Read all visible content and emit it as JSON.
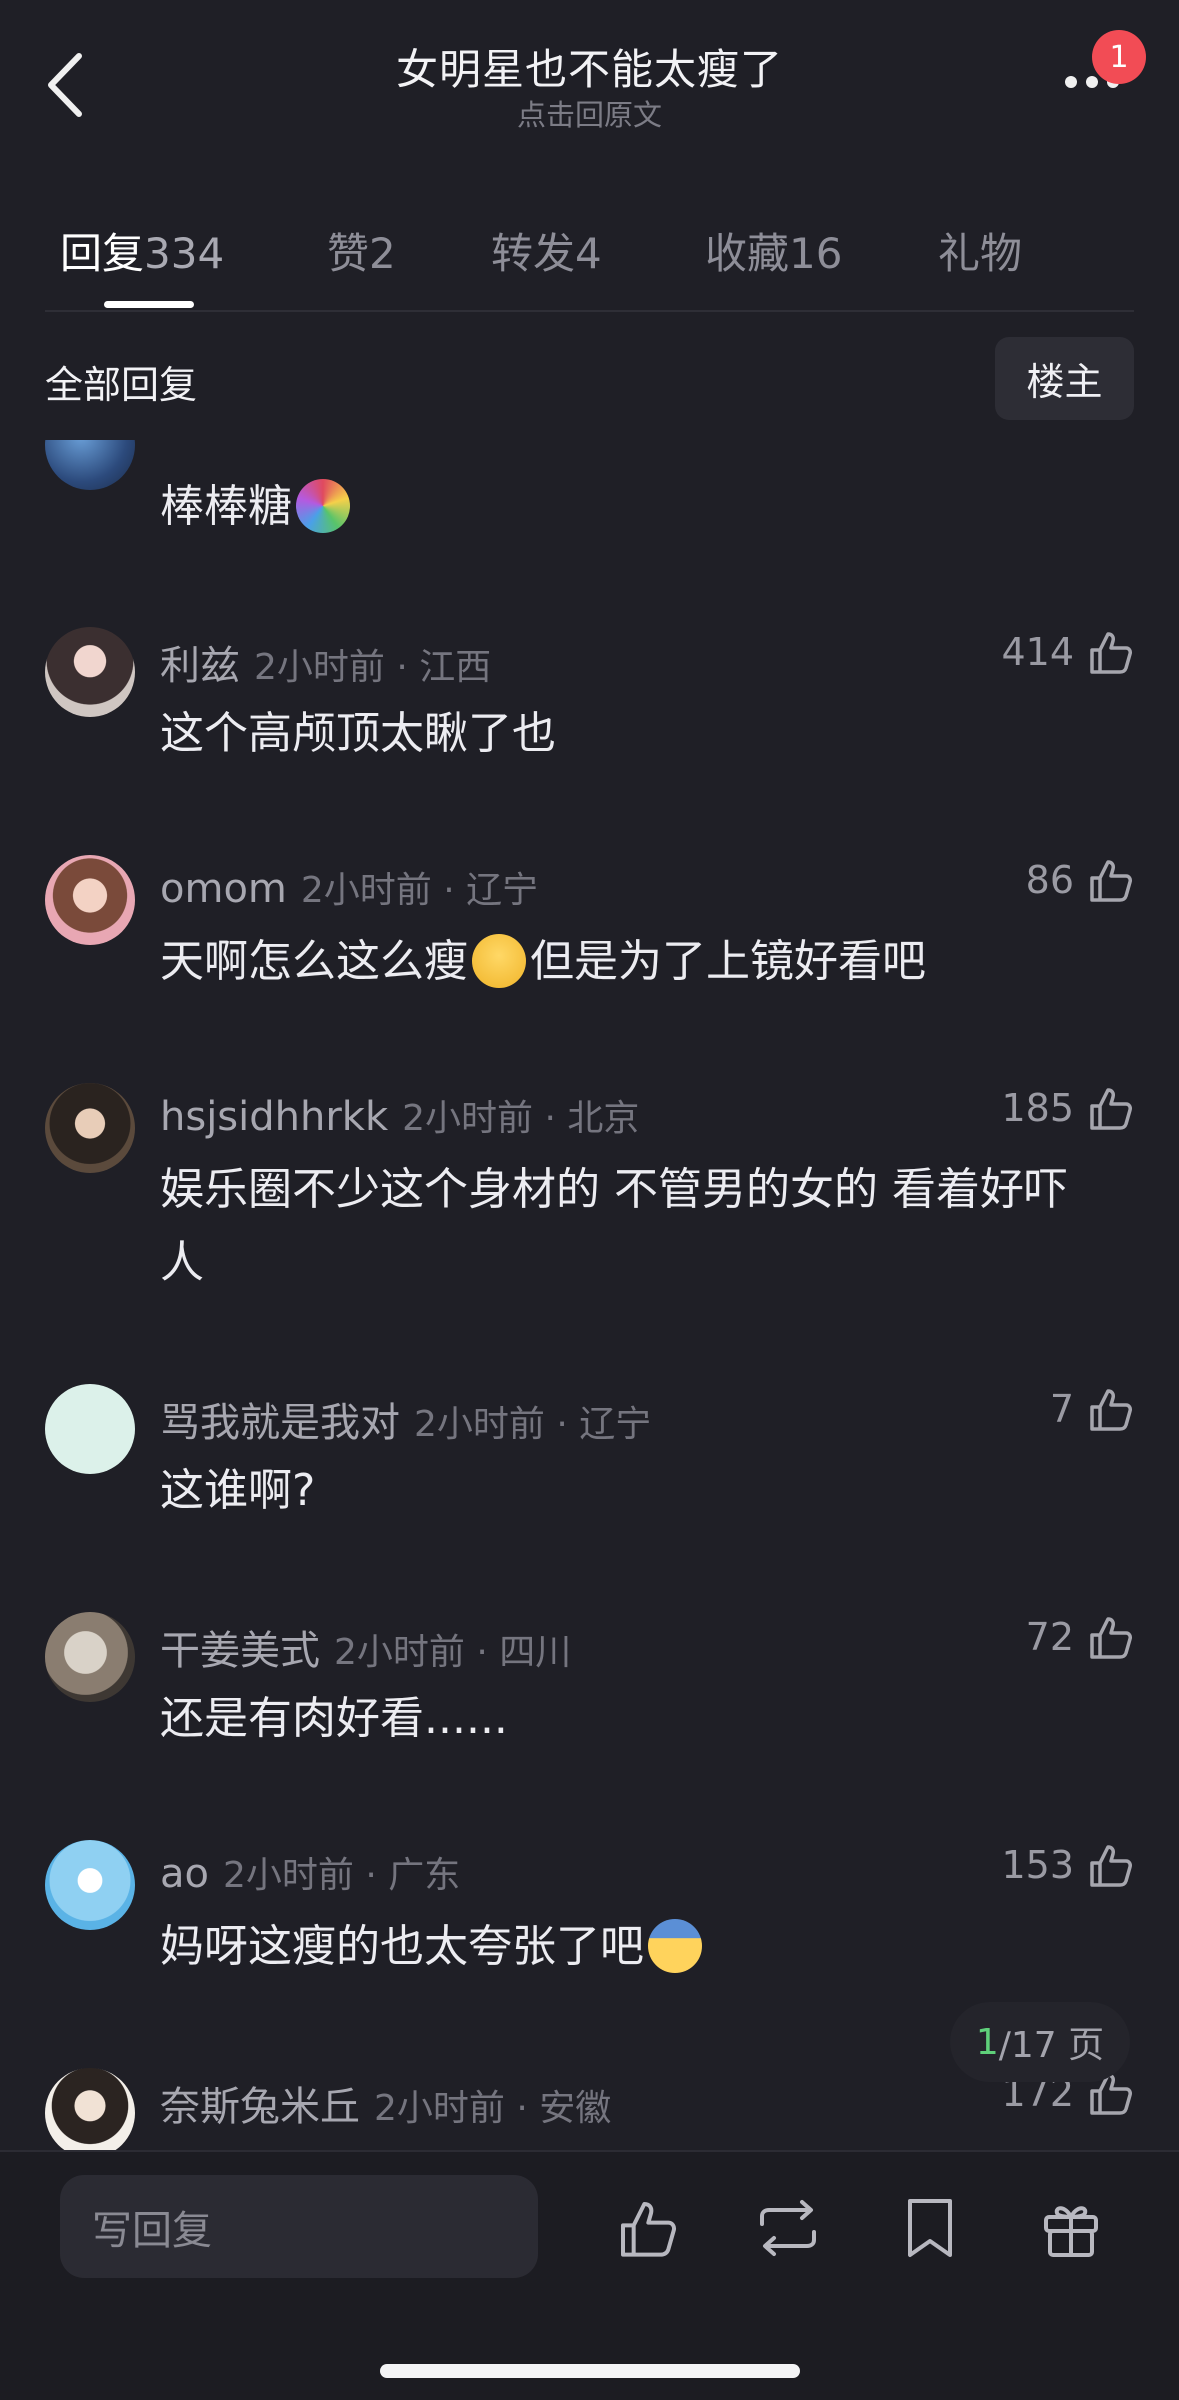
{
  "header": {
    "title": "女明星也不能太瘦了",
    "subtitle": "点击回原文",
    "notification_count": "1"
  },
  "tabs": [
    {
      "label": "回复",
      "count": "334",
      "active": true
    },
    {
      "label": "赞",
      "count": "2"
    },
    {
      "label": "转发",
      "count": "4"
    },
    {
      "label": "收藏",
      "count": "16"
    },
    {
      "label": "礼物",
      "count": ""
    }
  ],
  "filter": {
    "all_label": "全部回复",
    "op_label": "楼主"
  },
  "comments": [
    {
      "name": "",
      "time": "",
      "likes": "",
      "text": "棒棒糖",
      "emoji": "lollipop"
    },
    {
      "name": "利兹",
      "time": "2小时前 · 江西",
      "likes": "414",
      "text": "这个高颅顶太瞅了也"
    },
    {
      "name": "omom",
      "time": "2小时前 · 辽宁",
      "likes": "86",
      "text_before": "天啊怎么这么瘦",
      "text_after": "但是为了上镜好看吧",
      "emoji": "pleading-face"
    },
    {
      "name": "hsjsidhhrkk",
      "time": "2小时前 · 北京",
      "likes": "185",
      "text": "娱乐圈不少这个身材的 不管男的女的 看着好吓人"
    },
    {
      "name": "骂我就是我对",
      "time": "2小时前 · 辽宁",
      "likes": "7",
      "text": "这谁啊?"
    },
    {
      "name": "干姜美式",
      "time": "2小时前 · 四川",
      "likes": "72",
      "text": "还是有肉好看......"
    },
    {
      "name": "ao",
      "time": "2小时前 · 广东",
      "likes": "153",
      "text": "妈呀这瘦的也太夸张了吧",
      "emoji": "fearful-face"
    },
    {
      "name": "奈斯兔米丘",
      "time": "2小时前 · 安徽",
      "likes": "172",
      "text": ""
    }
  ],
  "pagination": {
    "current": "1",
    "total_label": "/17 页"
  },
  "bottom_bar": {
    "reply_placeholder": "写回复"
  },
  "colors": {
    "background": "#1f1f26",
    "badge": "#f24c55",
    "page_current": "#5fd07a"
  }
}
